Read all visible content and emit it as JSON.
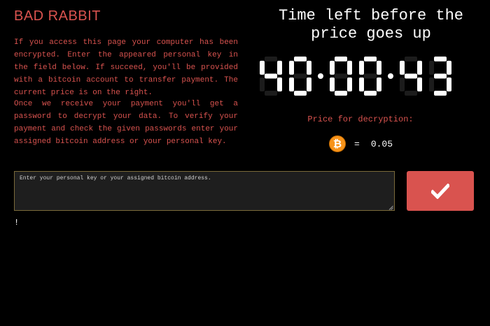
{
  "title": "BAD RABBIT",
  "intro_text": "If you access this page your computer has been encrypted. Enter the appeared personal key in the field below. If succeed, you'll be provided with a bitcoin account to transfer payment. The current price is on the right.",
  "instructions_text": "Once we receive your payment you'll get a password to decrypt your data. To verify your payment and check the given passwords enter your assigned bitcoin address or your personal key.",
  "timer": {
    "heading_line1": "Time left before the",
    "heading_line2": "price goes up",
    "value": "40:00:43",
    "digits": [
      "4",
      "0",
      "0",
      "0",
      "4",
      "3"
    ]
  },
  "price": {
    "label": "Price for decryption:",
    "currency_icon": "bitcoin-icon",
    "equals": "=",
    "amount": "0.05"
  },
  "key_input": {
    "placeholder": "Enter your personal key or your assigned bitcoin address.",
    "value": ""
  },
  "submit_icon": "checkmark-icon",
  "status_text": "!",
  "colors": {
    "accent": "#d9534f",
    "background": "#000000",
    "bitcoin": "#f7931a",
    "timer": "#ffffff"
  }
}
